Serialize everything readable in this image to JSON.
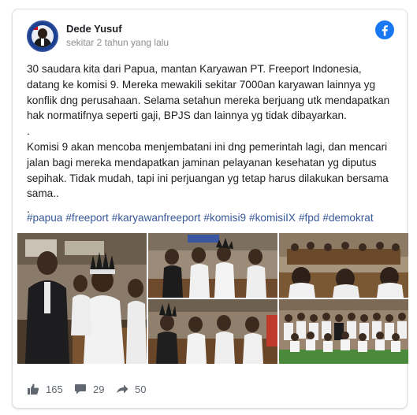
{
  "post": {
    "author": "Dede Yusuf",
    "time": "sekitar 2 tahun yang lalu",
    "body": "30 saudara kita dari Papua, mantan Karyawan PT. Freeport Indonesia,\ndatang ke komisi 9. Mereka mewakili sekitar 7000an karyawan lainnya yg\nkonflik dng perusahaan. Selama setahun mereka berjuang utk mendapatkan\nhak normatifnya seperti gaji, BPJS dan lainnya yg tidak dibayarkan.\n.\nKomisi 9 akan mencoba menjembatani ini dng pemerintah lagi, dan mencari\njalan bagi mereka mendapatkan jaminan pelayanan kesehatan yg diputus\nsepihak. Tidak mudah, tapi ini perjuangan yg tetap harus dilakukan bersama\nsama..\n.",
    "hashtags": [
      "#papua",
      "#freeport",
      "#karyawanfreeport",
      "#komisi9",
      "#komisiIX",
      "#fpd",
      "#demokrat"
    ]
  },
  "stats": {
    "likes": "165",
    "comments": "29",
    "shares": "50"
  },
  "colors": {
    "facebook_blue": "#1877f2",
    "hashtag": "#385898",
    "meta_gray": "#606770"
  },
  "icons": [
    "facebook-logo-icon",
    "like-icon",
    "comment-icon",
    "share-icon"
  ]
}
